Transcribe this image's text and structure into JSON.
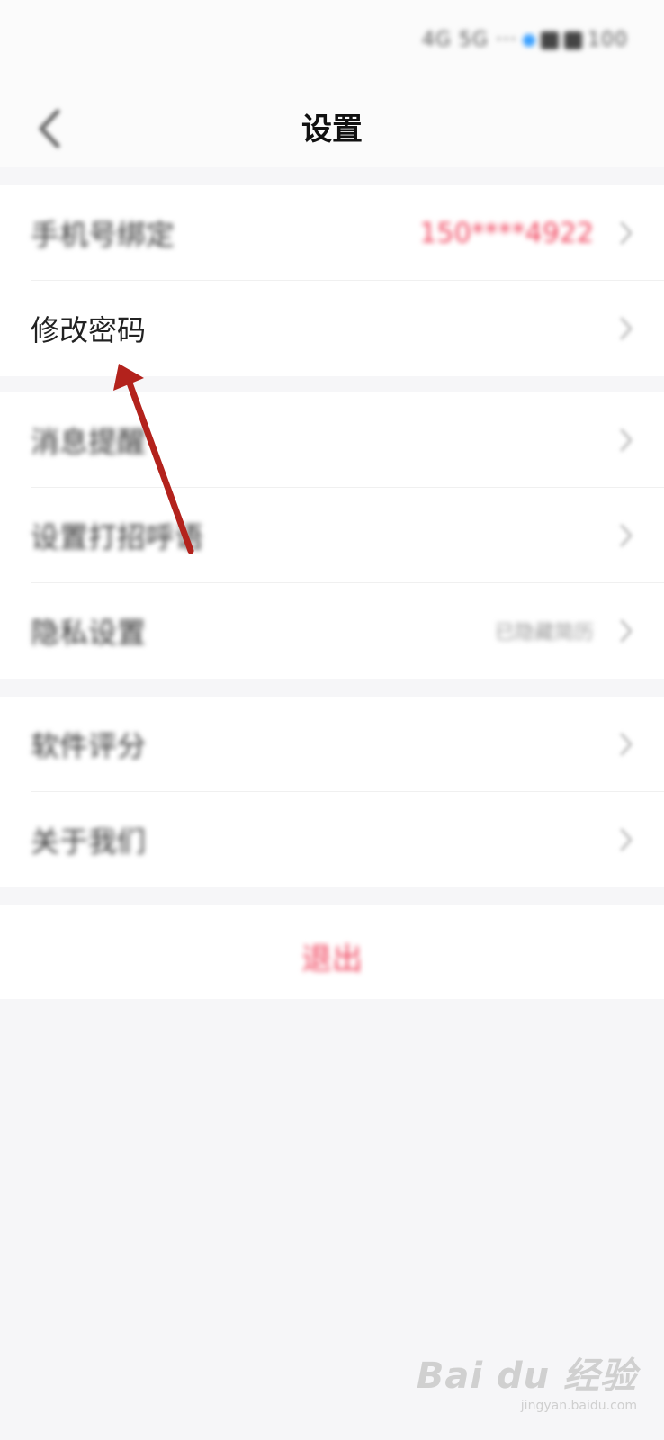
{
  "status_bar": {
    "blurred_text": "4G 5G ···",
    "battery_text": "100"
  },
  "nav": {
    "title": "设置",
    "back_icon": "chevron-left-icon"
  },
  "groups": [
    {
      "items": [
        {
          "label": "手机号绑定",
          "value": "150****4922",
          "value_color": "#f0405a",
          "blurred": true
        },
        {
          "label": "修改密码",
          "value": "",
          "blurred": false
        }
      ]
    },
    {
      "items": [
        {
          "label": "消息提醒",
          "value": "",
          "blurred": true
        },
        {
          "label": "设置打招呼语",
          "value": "",
          "blurred": true
        },
        {
          "label": "隐私设置",
          "value": "已隐藏简历",
          "blurred": true
        }
      ]
    },
    {
      "items": [
        {
          "label": "软件评分",
          "value": "",
          "blurred": true
        },
        {
          "label": "关于我们",
          "value": "",
          "blurred": true
        }
      ]
    }
  ],
  "logout": {
    "label": "退出",
    "color": "#f0405a"
  },
  "annotation": {
    "arrow_color": "#b3221c",
    "arrow_icon": "arrow-pointer-icon"
  },
  "watermark": {
    "logo": "Bai du 经验",
    "url": "jingyan.baidu.com"
  }
}
